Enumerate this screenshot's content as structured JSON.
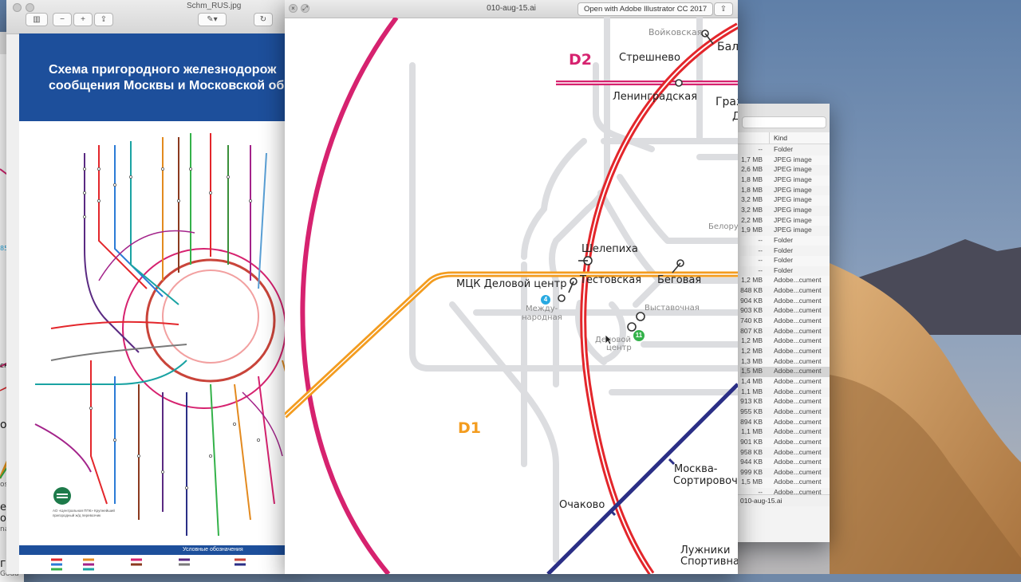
{
  "desktop": {
    "wallpaper": "Mojave",
    "sky_color": "#6f88a8",
    "dune_color": "#c99a5a"
  },
  "finder": {
    "columns": {
      "kind": "Kind"
    },
    "rows": [
      {
        "size": "--",
        "kind": "Folder"
      },
      {
        "size": "1,7 MB",
        "kind": "JPEG image"
      },
      {
        "size": "2,6 MB",
        "kind": "JPEG image"
      },
      {
        "size": "1,8 MB",
        "kind": "JPEG image"
      },
      {
        "size": "1,8 MB",
        "kind": "JPEG image"
      },
      {
        "size": "3,2 MB",
        "kind": "JPEG image"
      },
      {
        "size": "3,2 MB",
        "kind": "JPEG image"
      },
      {
        "size": "2,2 MB",
        "kind": "JPEG image"
      },
      {
        "size": "1,9 MB",
        "kind": "JPEG image"
      },
      {
        "size": "--",
        "kind": "Folder"
      },
      {
        "size": "--",
        "kind": "Folder"
      },
      {
        "size": "--",
        "kind": "Folder"
      },
      {
        "size": "--",
        "kind": "Folder"
      },
      {
        "size": "1,2 MB",
        "kind": "Adobe...cument"
      },
      {
        "size": "848 KB",
        "kind": "Adobe...cument"
      },
      {
        "size": "904 KB",
        "kind": "Adobe...cument"
      },
      {
        "size": "903 KB",
        "kind": "Adobe...cument"
      },
      {
        "size": "740 KB",
        "kind": "Adobe...cument"
      },
      {
        "size": "807 KB",
        "kind": "Adobe...cument"
      },
      {
        "size": "1,2 MB",
        "kind": "Adobe...cument"
      },
      {
        "size": "1,2 MB",
        "kind": "Adobe...cument"
      },
      {
        "size": "1,3 MB",
        "kind": "Adobe...cument"
      },
      {
        "size": "1,5 MB",
        "kind": "Adobe...cument"
      },
      {
        "size": "1,4 MB",
        "kind": "Adobe...cument"
      },
      {
        "size": "1,1 MB",
        "kind": "Adobe...cument"
      },
      {
        "size": "913 KB",
        "kind": "Adobe...cument"
      },
      {
        "size": "955 KB",
        "kind": "Adobe...cument"
      },
      {
        "size": "894 KB",
        "kind": "Adobe...cument"
      },
      {
        "size": "1,1 MB",
        "kind": "Adobe...cument"
      },
      {
        "size": "901 KB",
        "kind": "Adobe...cument"
      },
      {
        "size": "958 KB",
        "kind": "Adobe...cument"
      },
      {
        "size": "944 KB",
        "kind": "Adobe...cument"
      },
      {
        "size": "999 KB",
        "kind": "Adobe...cument"
      },
      {
        "size": "1,5 MB",
        "kind": "Adobe...cument"
      },
      {
        "size": "--",
        "kind": "Adobe...cument"
      }
    ],
    "selected_index": 22,
    "status": "010-aug-15.ai"
  },
  "preview_back": {
    "title": "Schm_RUS.jpg",
    "poster_title_1": "Схема пригородного железнодорож",
    "poster_title_2": "сообщения Москвы и Московской об",
    "legend_title": "Условные обозначения",
    "footer_small": "АО «Центральная ППК» Крупнейший пригородный ж/д перевозчик"
  },
  "left_edge": {
    "labels": [
      "ская",
      "оскв",
      "Ц",
      "oshevsk",
      "ежае",
      "ошё",
      "naevsk",
      "года",
      "Goda"
    ],
    "badge": "851"
  },
  "quicklook": {
    "title": "010-aug-15.ai",
    "open_button": "Open with Adobe Illustrator CC 2017",
    "close_icon": "×",
    "fullscreen_icon": "⤢",
    "share_icon": "⇪"
  },
  "map": {
    "d1": "D1",
    "d2": "D2",
    "stations": {
      "voykovskaya": "Войковская",
      "bal": "Бал",
      "streshnevo": "Стрешнево",
      "leningradskaya": "Ленинградская",
      "grazh": "Граж",
      "d_letter": "Д",
      "belor": "Белору",
      "shelepikha": "Шелепиха",
      "mck_delovoy": "МЦК Деловой центр",
      "testovskaya": "Тестовская",
      "begovaya": "Беговая",
      "mezhdu_1": "Между-",
      "mezhdu_2": "народная",
      "vystavochnaya": "Выставочная",
      "delovoy_1": "Деловой",
      "delovoy_2": "центр",
      "moskva_sort_1": "Москва-",
      "moskva_sort_2": "Сортировоч",
      "ochakovo": "Очаково",
      "luzhniki_1": "Лужники",
      "luzhniki_2": "Спортивна"
    },
    "line_badges": {
      "l4": "4",
      "l11": "11"
    },
    "colors": {
      "d1_orange": "#f39c1f",
      "d2_magenta": "#d6226f",
      "mcc_red": "#e3262b",
      "navy": "#2b2f86",
      "metro_gray": "#d9dadc",
      "badge_cyan": "#27a9e1",
      "badge_green": "#34b24a"
    }
  }
}
